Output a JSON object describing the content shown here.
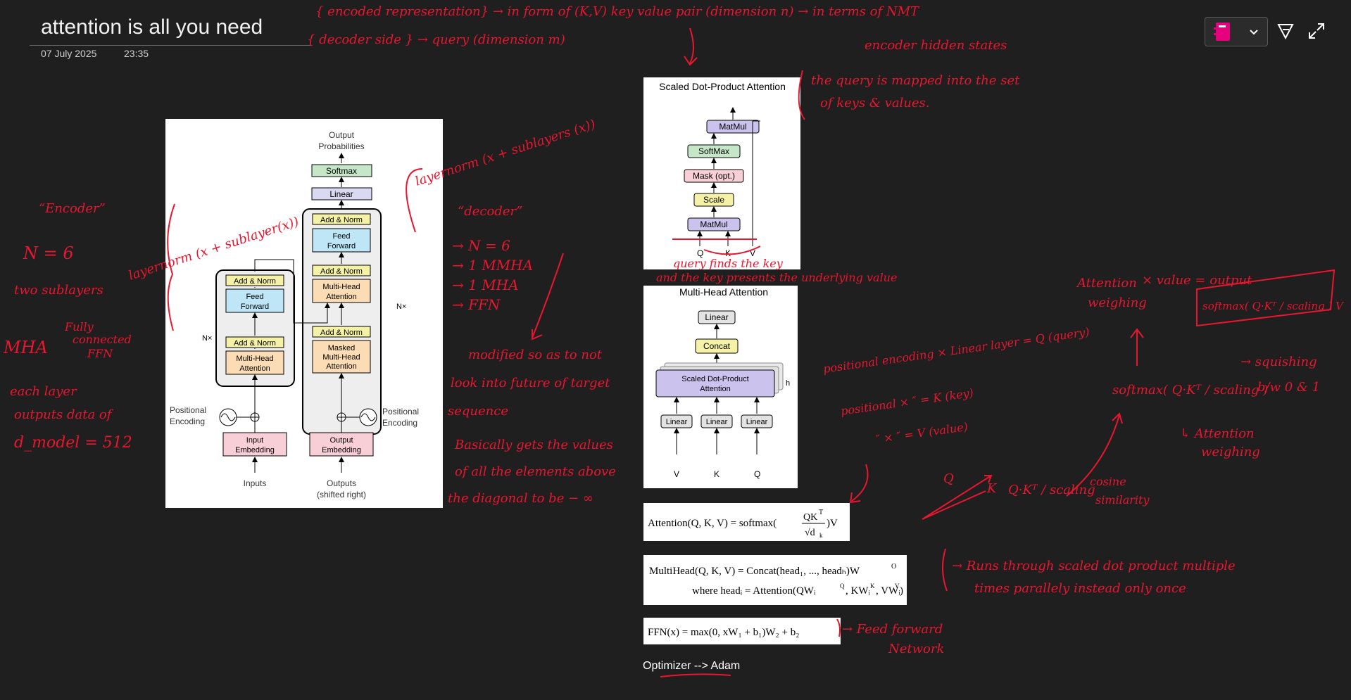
{
  "page": {
    "title": "attention is all you need",
    "date": "07 July 2025",
    "time": "23:35",
    "toolbar": {
      "notebook_icon": "notebook-icon",
      "dropdown_icon": "chevron-down-icon",
      "pen_icon": "pen-filter-icon",
      "expand_icon": "expand-icon",
      "accent": "#e6007e"
    }
  },
  "transformer": {
    "output_probabilities": [
      "Output",
      "Probabilities"
    ],
    "softmax": "Softmax",
    "linear": "Linear",
    "add_norm": "Add & Norm",
    "feed_forward": [
      "Feed",
      "Forward"
    ],
    "multi_head_attention": [
      "Multi-Head",
      "Attention"
    ],
    "masked_mha": [
      "Masked",
      "Multi-Head",
      "Attention"
    ],
    "positional_encoding": [
      "Positional",
      "Encoding"
    ],
    "input_embedding": [
      "Input",
      "Embedding"
    ],
    "output_embedding": [
      "Output",
      "Embedding"
    ],
    "inputs": "Inputs",
    "outputs": [
      "Outputs",
      "(shifted right)"
    ],
    "nx": "N×"
  },
  "sdpa": {
    "title": "Scaled Dot-Product Attention",
    "matmul": "MatMul",
    "softmax": "SoftMax",
    "mask": "Mask (opt.)",
    "scale": "Scale",
    "q": "Q",
    "k": "K",
    "v": "V"
  },
  "mha": {
    "title": "Multi-Head Attention",
    "linear": "Linear",
    "concat": "Concat",
    "sdpa": [
      "Scaled Dot-Product",
      "Attention"
    ],
    "h": "h",
    "v": "V",
    "k": "K",
    "q": "Q"
  },
  "equations": {
    "attention_lhs": "Attention(Q, K, V) = softmax(",
    "attention_num": "QK",
    "attention_sup": "T",
    "attention_den": "√d",
    "attention_den_sub": "k",
    "attention_rhs": ")V",
    "multihead_line1": "MultiHead(Q, K, V) = Concat(head₁, ..., headₕ)W",
    "multihead_line1_sup": "O",
    "multihead_line2": "where headᵢ = Attention(QWᵢ",
    "multihead_line2_sup1": "Q",
    "multihead_line2_mid1": ", KWᵢ",
    "multihead_line2_sup2": "K",
    "multihead_line2_mid2": ", VWᵢ",
    "multihead_line2_sup3": "V",
    "multihead_line2_end": ")",
    "ffn": "FFN(x) = max(0, xW₁ + b₁)W₂ + b₂"
  },
  "optimizer": "Optimizer --> Adam",
  "handwriting": {
    "ink_color": "#e8172f",
    "top1": "{ encoded representation} → in form of (K,V) key value pair (dimension n) → in terms of NMT",
    "top2": "{ decoder side } → query (dimension m)",
    "encoder_hidden": "encoder hidden states",
    "query_mapped1": "the query is mapped into the set",
    "query_mapped2": "of keys & values.",
    "encoder_label": "“Encoder”",
    "n6_left": "N = 6",
    "two_sublayers": "two sublayers",
    "mha_left": "MHA",
    "fully_connected": [
      "Fully",
      "connected",
      "FFN"
    ],
    "each_layer": [
      "each layer",
      "outputs data of",
      "d_model = 512"
    ],
    "layernorm_left": "layernorm (x + sublayer(x))",
    "layernorm_right": "layernorm (x + sublayers (x))",
    "decoder_label": "“decoder”",
    "decoder_points": [
      "→ N = 6",
      "→ 1 MMHA",
      "→ 1 MHA",
      "→ FFN"
    ],
    "modified": [
      "modified so as to not",
      "look into future of target",
      "sequence"
    ],
    "basically": [
      "Basically gets the values",
      "of all the elements above",
      "the diagonal to be − ∞"
    ],
    "query_finds": "query finds the key",
    "key_presents": "and the key presents the underlying value",
    "pos_enc_rows": [
      "positional encoding × Linear layer = Q (query)",
      "positional × ″ = K (key)",
      "″ × ″ = V (value)"
    ],
    "attention_weighing": [
      "Attention",
      "weighing"
    ],
    "times_value": "× value = output",
    "softmax_box": "softmax( Q·Kᵀ / scaling ) V",
    "softmax_mid": "softmax( Q·Kᵀ / scaling )",
    "squishing": [
      "→ squishing",
      "b/w 0 & 1"
    ],
    "attention_weighing2": [
      "↳ Attention",
      "weighing"
    ],
    "qk_vectors": [
      "Q",
      "K"
    ],
    "qk_scaling": "Q·Kᵀ / scaling",
    "cosine": [
      "cosine",
      "similarity"
    ],
    "runs_through": [
      "→ Runs through scaled dot product multiple",
      "times parallely instead only once"
    ],
    "feed_forward_net": [
      "→ Feed forward",
      "Network"
    ]
  }
}
